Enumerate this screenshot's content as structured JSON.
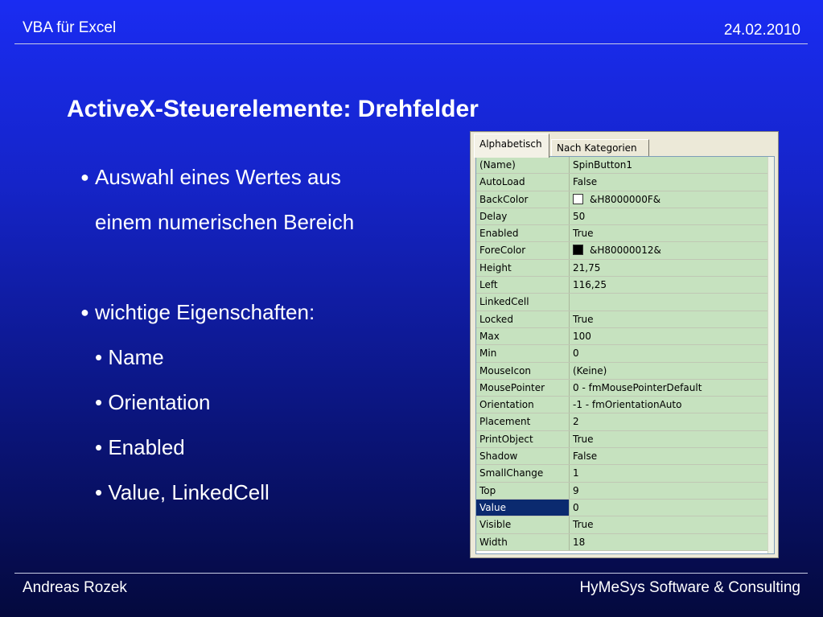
{
  "header": {
    "left": "VBA für Excel",
    "right": "24.02.2010"
  },
  "slide": {
    "title": "ActiveX-Steuerelemente: Drehfelder",
    "bullets": {
      "b1_line1": "Auswahl eines Wertes aus",
      "b1_line2": "einem numerischen Bereich",
      "b2": "wichtige Eigenschaften:",
      "subs": [
        "• Name",
        "• Orientation",
        "• Enabled",
        "• Value, LinkedCell"
      ]
    }
  },
  "properties_window": {
    "tabs": [
      "Alphabetisch",
      "Nach Kategorien"
    ],
    "rows": [
      {
        "name": "(Name)",
        "value": "SpinButton1"
      },
      {
        "name": "AutoLoad",
        "value": "False"
      },
      {
        "name": "BackColor",
        "value": "&H8000000F&",
        "swatch": "#ffffff"
      },
      {
        "name": "Delay",
        "value": "50"
      },
      {
        "name": "Enabled",
        "value": "True"
      },
      {
        "name": "ForeColor",
        "value": "&H80000012&",
        "swatch": "#000000"
      },
      {
        "name": "Height",
        "value": "21,75"
      },
      {
        "name": "Left",
        "value": "116,25"
      },
      {
        "name": "LinkedCell",
        "value": ""
      },
      {
        "name": "Locked",
        "value": "True"
      },
      {
        "name": "Max",
        "value": "100"
      },
      {
        "name": "Min",
        "value": "0"
      },
      {
        "name": "MouseIcon",
        "value": "(Keine)"
      },
      {
        "name": "MousePointer",
        "value": "0 - fmMousePointerDefault"
      },
      {
        "name": "Orientation",
        "value": "-1 - fmOrientationAuto"
      },
      {
        "name": "Placement",
        "value": "2"
      },
      {
        "name": "PrintObject",
        "value": "True"
      },
      {
        "name": "Shadow",
        "value": "False"
      },
      {
        "name": "SmallChange",
        "value": "1"
      },
      {
        "name": "Top",
        "value": "9"
      },
      {
        "name": "Value",
        "value": "0",
        "selected": true
      },
      {
        "name": "Visible",
        "value": "True"
      },
      {
        "name": "Width",
        "value": "18"
      }
    ]
  },
  "footer": {
    "left": "Andreas Rozek",
    "right": "HyMeSys Software & Consulting"
  }
}
